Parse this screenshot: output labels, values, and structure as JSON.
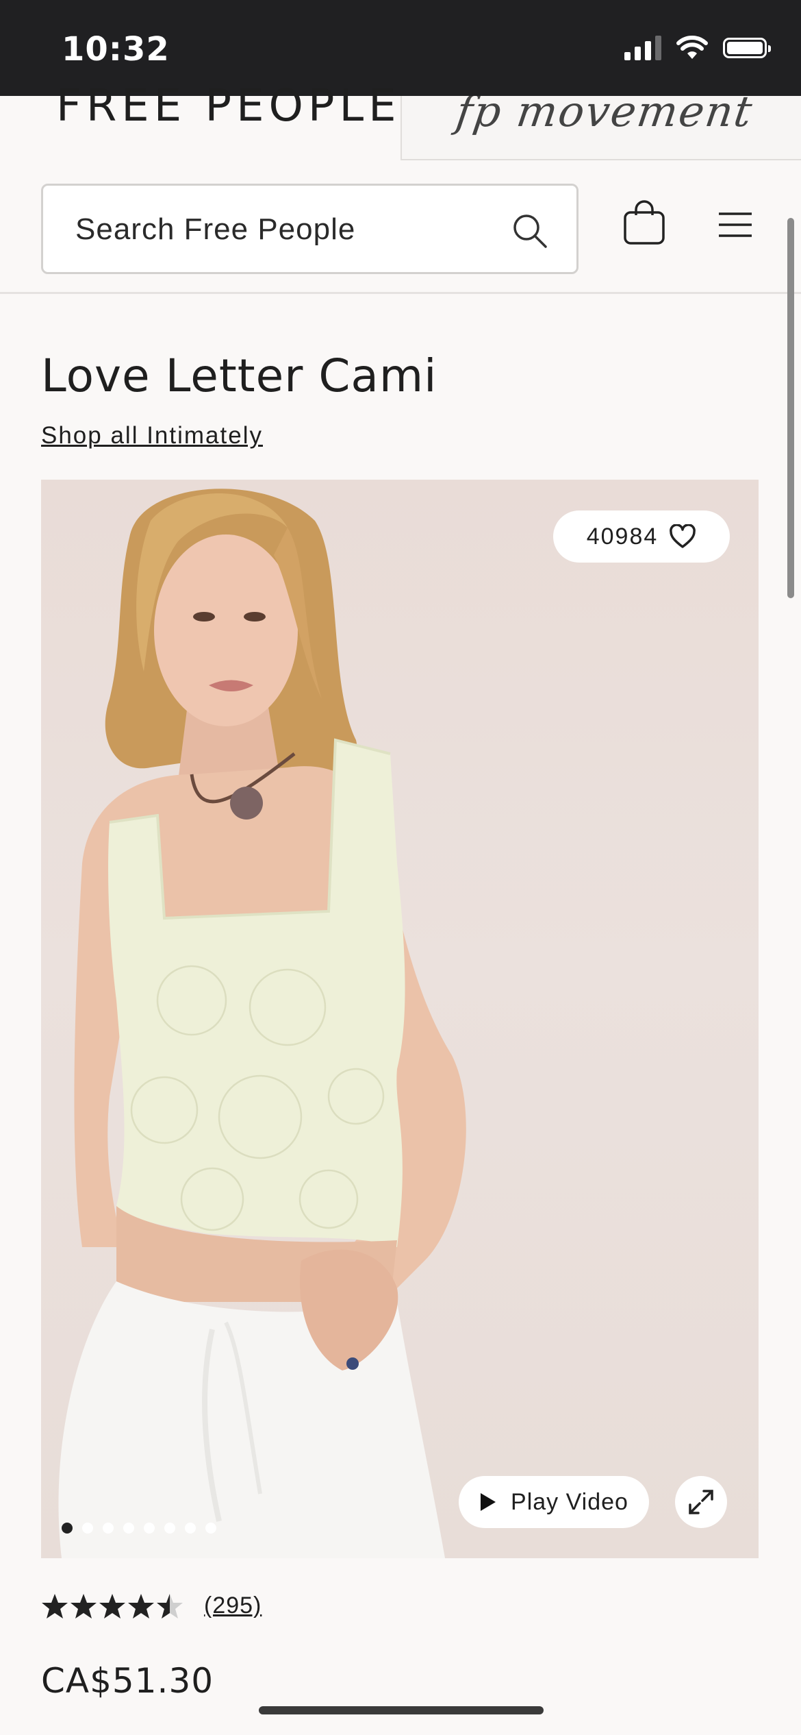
{
  "status_bar": {
    "time": "10:32"
  },
  "brand": {
    "logo": "FREE PEOPLE",
    "movement_logo": "fp movement"
  },
  "search": {
    "placeholder": "Search Free People"
  },
  "product": {
    "title": "Love Letter Cami",
    "shop_link": "Shop all Intimately",
    "wishlist_count": "40984",
    "play_video_label": "Play Video",
    "gallery": {
      "slide_count": 8,
      "active_index": 0
    },
    "rating": {
      "stars": 4.5,
      "review_count": "(295)"
    },
    "price": "CA$51.30"
  },
  "colors": {
    "status_bar_bg": "#202022",
    "page_bg": "#faf8f7",
    "top_color": "#eef0d8"
  },
  "icons": [
    "search-icon",
    "bag-icon",
    "menu-icon",
    "heart-icon",
    "play-icon",
    "expand-icon",
    "star-icon"
  ]
}
